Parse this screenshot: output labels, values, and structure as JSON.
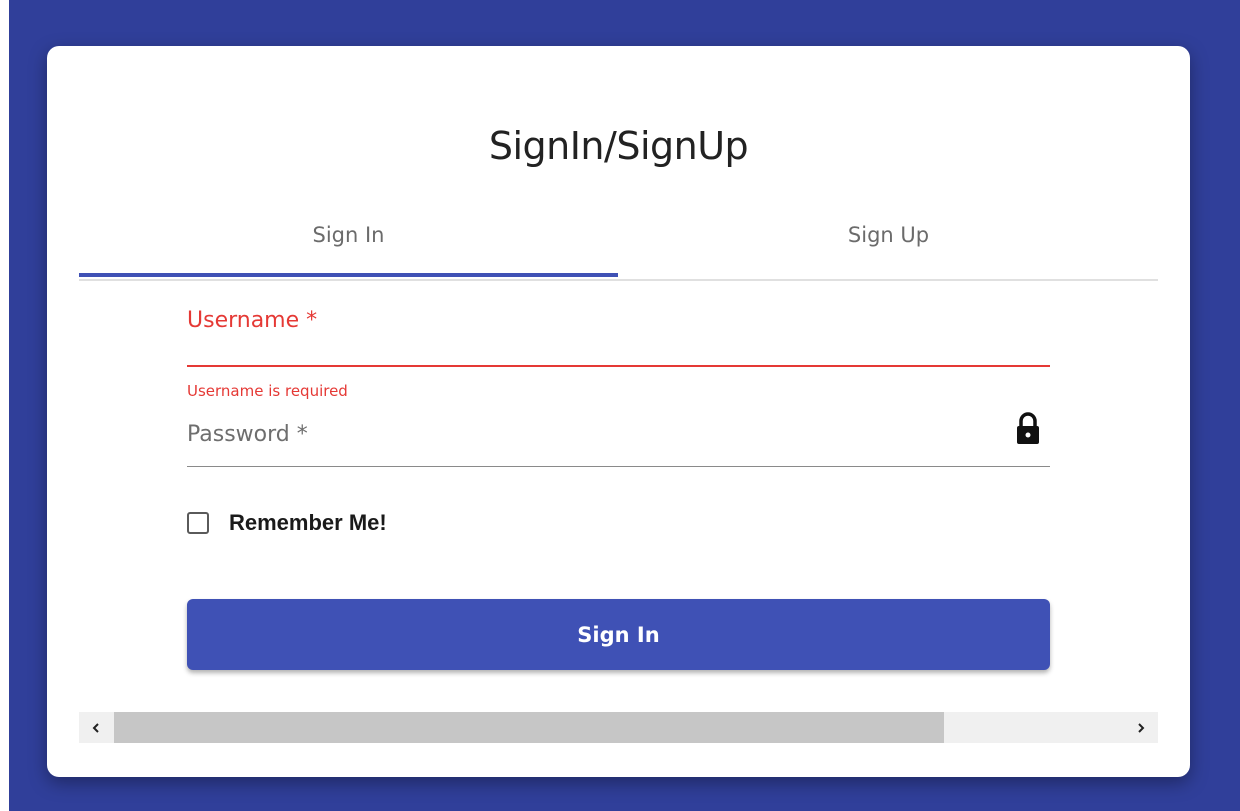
{
  "card": {
    "title": "SignIn/SignUp"
  },
  "tabs": {
    "items": [
      {
        "label": "Sign In",
        "active": true
      },
      {
        "label": "Sign Up",
        "active": false
      }
    ]
  },
  "form": {
    "username": {
      "label": "Username *",
      "value": "",
      "error": "Username is required"
    },
    "password": {
      "label": "Password *",
      "value": "",
      "icon": "lock-icon"
    },
    "remember": {
      "label": "Remember Me!",
      "checked": false
    },
    "submit_label": "Sign In"
  },
  "colors": {
    "background": "#303f9a",
    "primary": "#3f51b5",
    "error": "#e53935"
  }
}
